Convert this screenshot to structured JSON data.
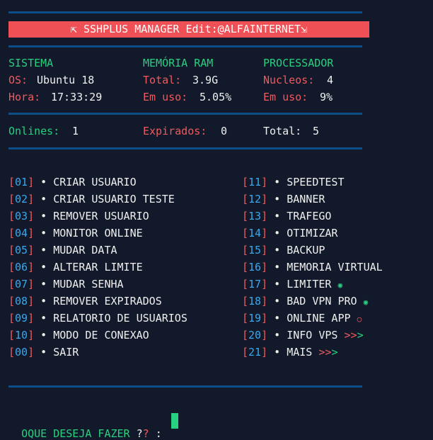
{
  "header": {
    "title": "⇱ SSHPLUS MANAGER Edit:@ALFAINTERNET⇲"
  },
  "system": {
    "title": "SISTEMA",
    "os_label": "OS:",
    "os_value": "Ubuntu 18",
    "time_label": "Hora:",
    "time_value": "17:33:29"
  },
  "memory": {
    "title": "MEMÓRIA RAM",
    "total_label": "Total:",
    "total_value": "3.9G",
    "used_label": "Em uso:",
    "used_value": "5.05%"
  },
  "cpu": {
    "title": "PROCESSADOR",
    "cores_label": "Nucleos:",
    "cores_value": "4",
    "used_label": "Em uso:",
    "used_value": "9%"
  },
  "stats": {
    "online_label": "Onlines:",
    "online_value": "1",
    "expired_label": "Expirados:",
    "expired_value": "0",
    "total_label": "Total:",
    "total_value": "5"
  },
  "menu_left": [
    {
      "num": "01",
      "label": "CRIAR USUARIO"
    },
    {
      "num": "02",
      "label": "CRIAR USUARIO TESTE"
    },
    {
      "num": "03",
      "label": "REMOVER USUARIO"
    },
    {
      "num": "04",
      "label": "MONITOR ONLINE"
    },
    {
      "num": "05",
      "label": "MUDAR DATA"
    },
    {
      "num": "06",
      "label": "ALTERAR LIMITE"
    },
    {
      "num": "07",
      "label": "MUDAR SENHA"
    },
    {
      "num": "08",
      "label": "REMOVER EXPIRADOS"
    },
    {
      "num": "09",
      "label": "RELATORIO DE USUARIOS"
    },
    {
      "num": "10",
      "label": "MODO DE CONEXAO"
    },
    {
      "num": "00",
      "label": "SAIR"
    }
  ],
  "menu_right": [
    {
      "num": "11",
      "label": "SPEEDTEST"
    },
    {
      "num": "12",
      "label": "BANNER"
    },
    {
      "num": "13",
      "label": "TRAFEGO"
    },
    {
      "num": "14",
      "label": "OTIMIZAR"
    },
    {
      "num": "15",
      "label": "BACKUP"
    },
    {
      "num": "16",
      "label": "MEMORIA VIRTUAL"
    },
    {
      "num": "17",
      "label": "LIMITER"
    },
    {
      "num": "18",
      "label": "BAD VPN PRO"
    },
    {
      "num": "19",
      "label": "ONLINE APP"
    },
    {
      "num": "20",
      "label": "INFO VPS"
    },
    {
      "num": "21",
      "label": "MAIS"
    }
  ],
  "prompt": {
    "text": "OQUE DESEJA FAZER",
    "q1": "?",
    "q2": "?",
    "colon": ":"
  },
  "colors": {
    "background": "#11192a",
    "accent_red": "#ee5056",
    "green": "#27d17f",
    "blue": "#3aa8ea",
    "rule": "#0e4e86"
  }
}
